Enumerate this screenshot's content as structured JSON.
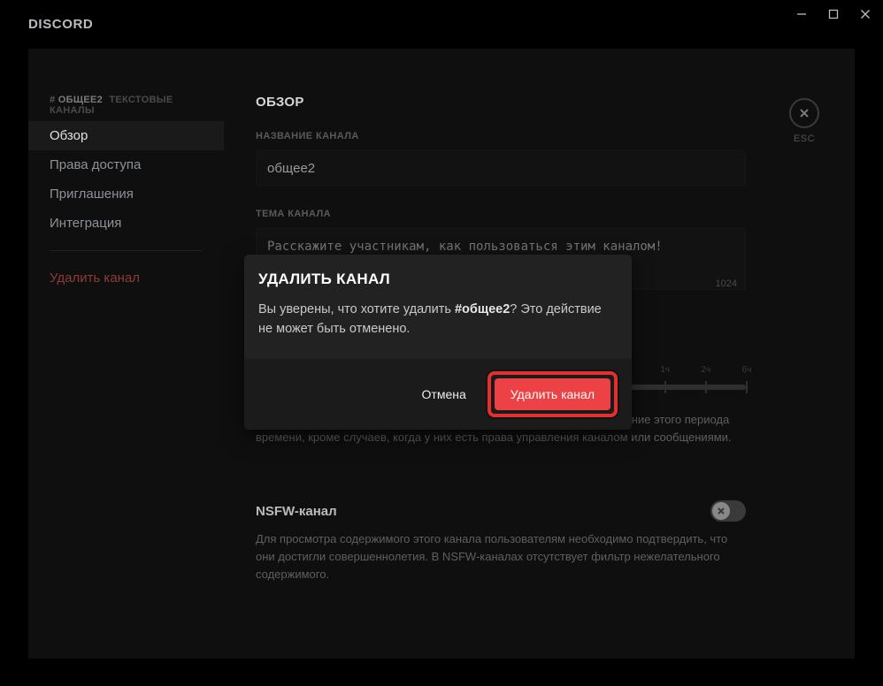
{
  "titlebar": {
    "brand": "DISCORD"
  },
  "esc_label": "ESC",
  "sidebar": {
    "category_prefix": "#",
    "category_name": "ОБЩЕЕ2",
    "category_sub": "ТЕКСТОВЫЕ КАНАЛЫ",
    "items": [
      "Обзор",
      "Права доступа",
      "Приглашения",
      "Интеграция"
    ],
    "delete_label": "Удалить канал"
  },
  "main": {
    "section_title": "ОБЗОР",
    "name_label": "НАЗВАНИЕ КАНАЛА",
    "name_value": "общее2",
    "topic_label": "ТЕМА КАНАЛА",
    "topic_placeholder": "Расскажите участникам, как пользоваться этим каналом!",
    "topic_counter": "1024",
    "slow_help": "Пользователи не смогут отправлять больше одного сообщения в течение этого периода времени, кроме случаев, когда у них есть права управления каналом или сообщениями.",
    "slider_ticks": [
      "",
      "",
      "",
      "",
      "",
      "",
      "",
      "",
      "",
      "",
      "1ч",
      "2ч",
      "6ч"
    ],
    "nsfw_title": "NSFW-канал",
    "nsfw_desc": "Для просмотра содержимого этого канала пользователям необходимо подтвердить, что они достигли совершеннолетия. В NSFW-каналах отсутствует фильтр нежелательного содержимого."
  },
  "modal": {
    "title": "УДАЛИТЬ КАНАЛ",
    "body_pre": "Вы уверены, что хотите удалить ",
    "body_channel": "#общее2",
    "body_post": "? Это действие не может быть отменено.",
    "cancel": "Отмена",
    "delete": "Удалить канал"
  }
}
